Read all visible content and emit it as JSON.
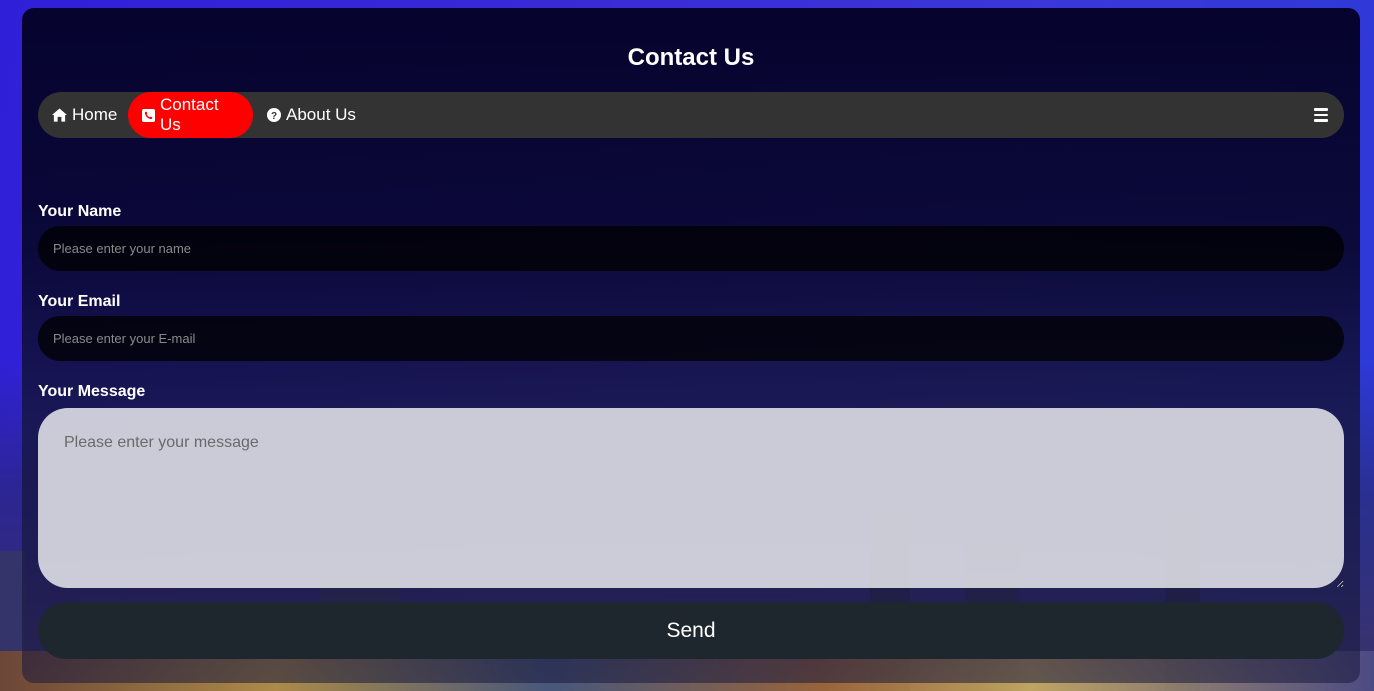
{
  "header": {
    "title": "Contact Us"
  },
  "nav": {
    "items": [
      {
        "label": "Home",
        "icon": "home-icon"
      },
      {
        "label": "Contact Us",
        "icon": "phone-square-icon",
        "active": true
      },
      {
        "label": "About Us",
        "icon": "question-circle-icon"
      }
    ],
    "menu_icon": "hamburger-menu-icon",
    "active_color": "#ff0000",
    "bar_color": "#333333"
  },
  "form": {
    "name": {
      "label": "Your Name",
      "placeholder": "Please enter your name",
      "value": ""
    },
    "email": {
      "label": "Your Email",
      "placeholder": "Please enter your E-mail",
      "value": ""
    },
    "message": {
      "label": "Your Message",
      "placeholder": "Please enter your message",
      "value": ""
    },
    "submit_label": "Send"
  }
}
